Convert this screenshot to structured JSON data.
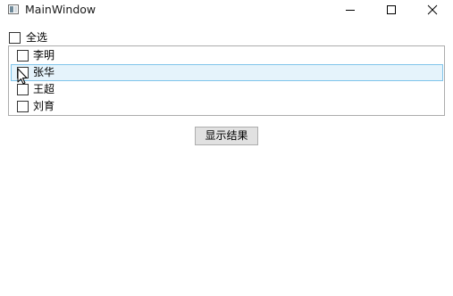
{
  "window": {
    "title": "MainWindow",
    "icon": "app-window-icon",
    "controls": [
      "minimize-icon",
      "maximize-icon",
      "close-icon"
    ]
  },
  "select_all": {
    "label": "全选",
    "checked": false
  },
  "list": {
    "items": [
      {
        "label": "李明",
        "checked": false,
        "hovered": false
      },
      {
        "label": "张华",
        "checked": false,
        "hovered": true
      },
      {
        "label": "王超",
        "checked": false,
        "hovered": false
      },
      {
        "label": "刘育",
        "checked": false,
        "hovered": false
      }
    ]
  },
  "show_button": {
    "label": "显示结果"
  },
  "colors": {
    "hover_fill": "#e5f3fb",
    "hover_border": "#7fc4ea",
    "button_fill": "#e1e1e1"
  }
}
